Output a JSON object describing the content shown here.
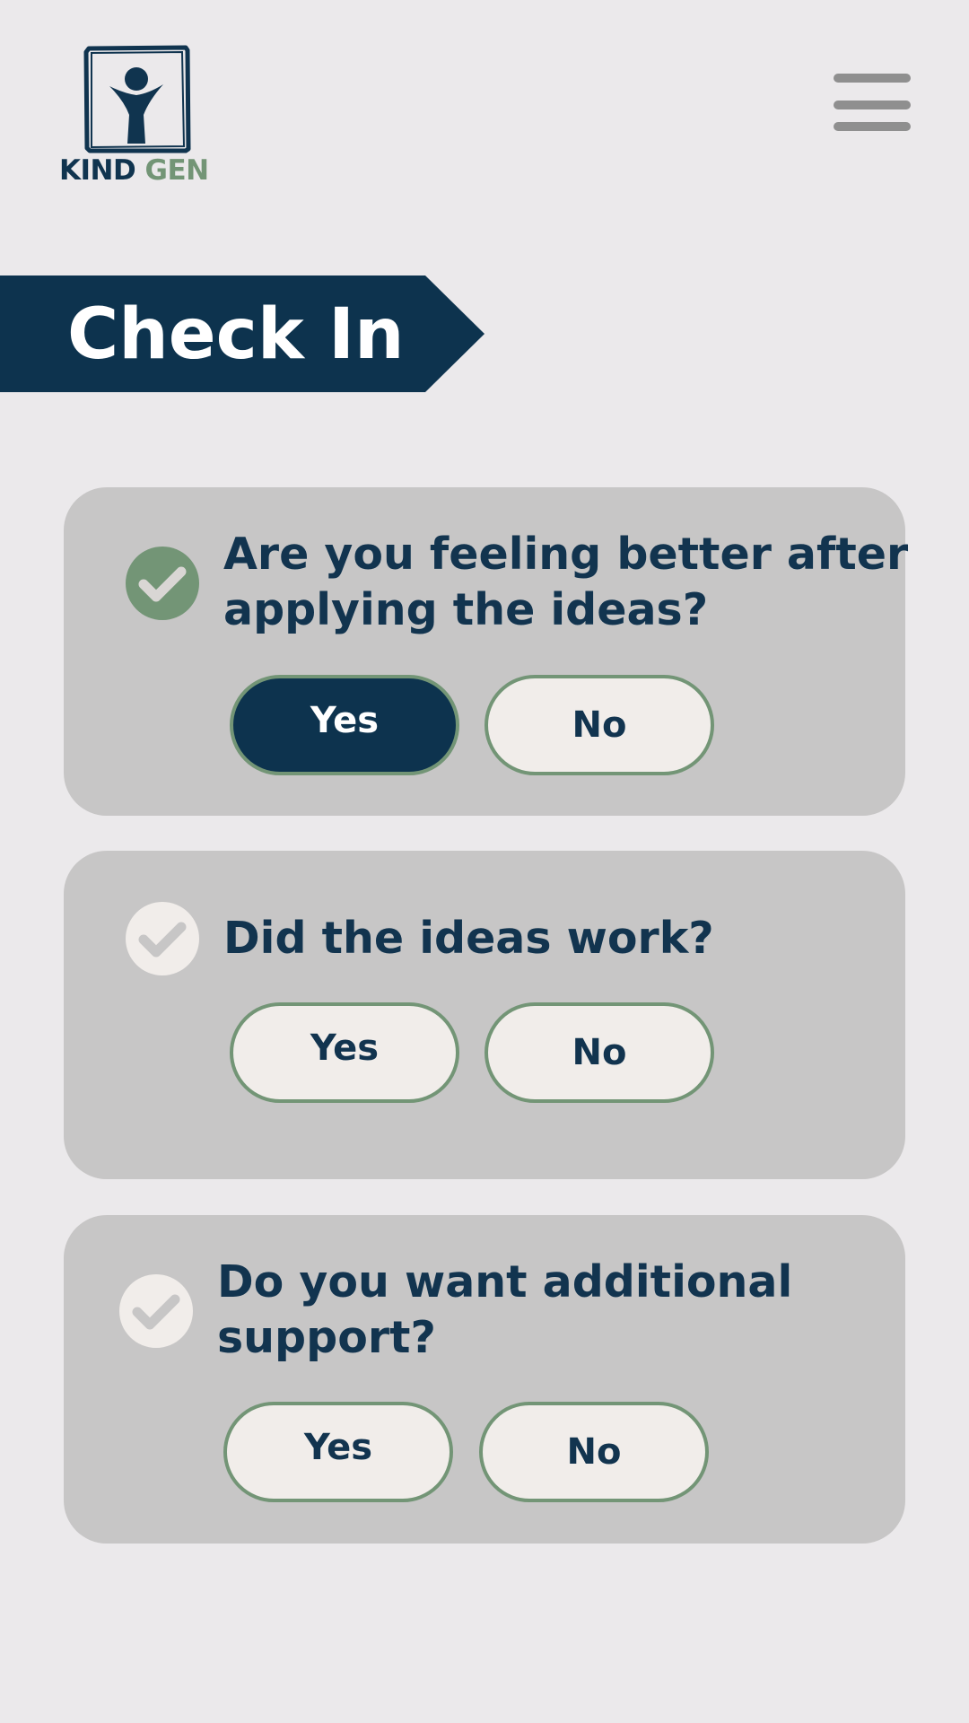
{
  "header": {
    "logo_part1": "KIND",
    "logo_part2": "GEN",
    "menu_icon": "hamburger-menu-icon"
  },
  "page_title": "Check In",
  "colors": {
    "background": "#ebe9eb",
    "card": "#c7c6c6",
    "navy": "#0d334e",
    "green": "#739576",
    "button_bg": "#f1edea",
    "check_inactive": "#f1edea"
  },
  "questions": [
    {
      "text_line1": "Are you feeling better after",
      "text_line2": "applying the ideas?",
      "answered": true,
      "status_icon": "check-circle-icon",
      "yes_label": "Yes",
      "no_label": "No",
      "selected": "Yes"
    },
    {
      "text_line1": "Did the ideas work?",
      "text_line2": "",
      "answered": false,
      "status_icon": "check-circle-icon",
      "yes_label": "Yes",
      "no_label": "No",
      "selected": ""
    },
    {
      "text_line1": "Do you want additional",
      "text_line2": "support?",
      "answered": false,
      "status_icon": "check-circle-icon",
      "yes_label": "Yes",
      "no_label": "No",
      "selected": ""
    }
  ]
}
